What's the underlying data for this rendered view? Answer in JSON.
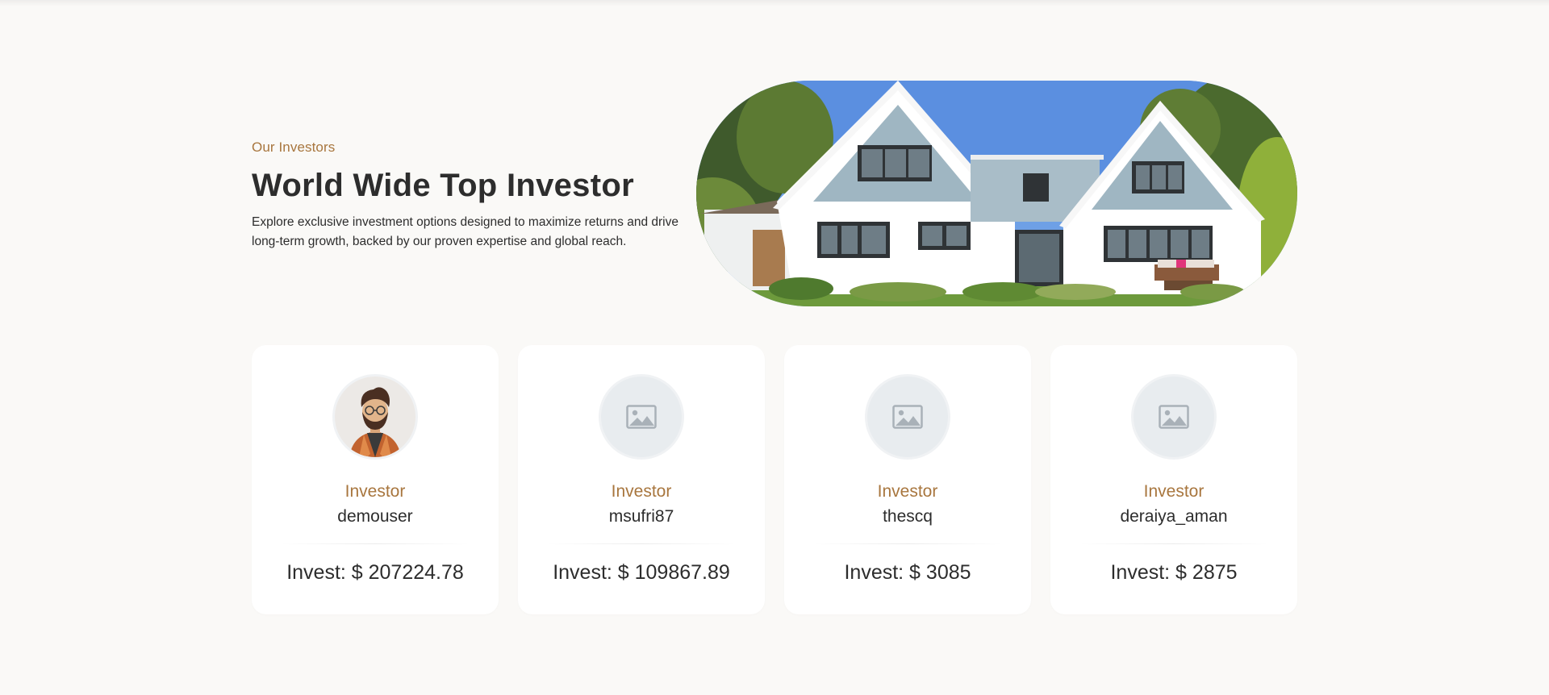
{
  "section": {
    "eyebrow": "Our Investors",
    "title": "World Wide Top Investor",
    "description": "Explore exclusive investment options designed to maximize returns and drive long-term growth, backed by our proven expertise and global reach."
  },
  "hero_image": {
    "icon": "house-photo"
  },
  "investors": [
    {
      "role": "Investor",
      "username": "demouser",
      "invest": "Invest: $ 207224.78",
      "avatar": "cartoon-man-avatar"
    },
    {
      "role": "Investor",
      "username": "msufri87",
      "invest": "Invest: $ 109867.89",
      "avatar": "image-placeholder-icon"
    },
    {
      "role": "Investor",
      "username": "thescq",
      "invest": "Invest: $ 3085",
      "avatar": "image-placeholder-icon"
    },
    {
      "role": "Investor",
      "username": "deraiya_aman",
      "invest": "Invest: $ 2875",
      "avatar": "image-placeholder-icon"
    }
  ],
  "colors": {
    "accent": "#a8763e",
    "background": "#faf9f7",
    "card": "#ffffff",
    "text": "#2d2d2d"
  }
}
